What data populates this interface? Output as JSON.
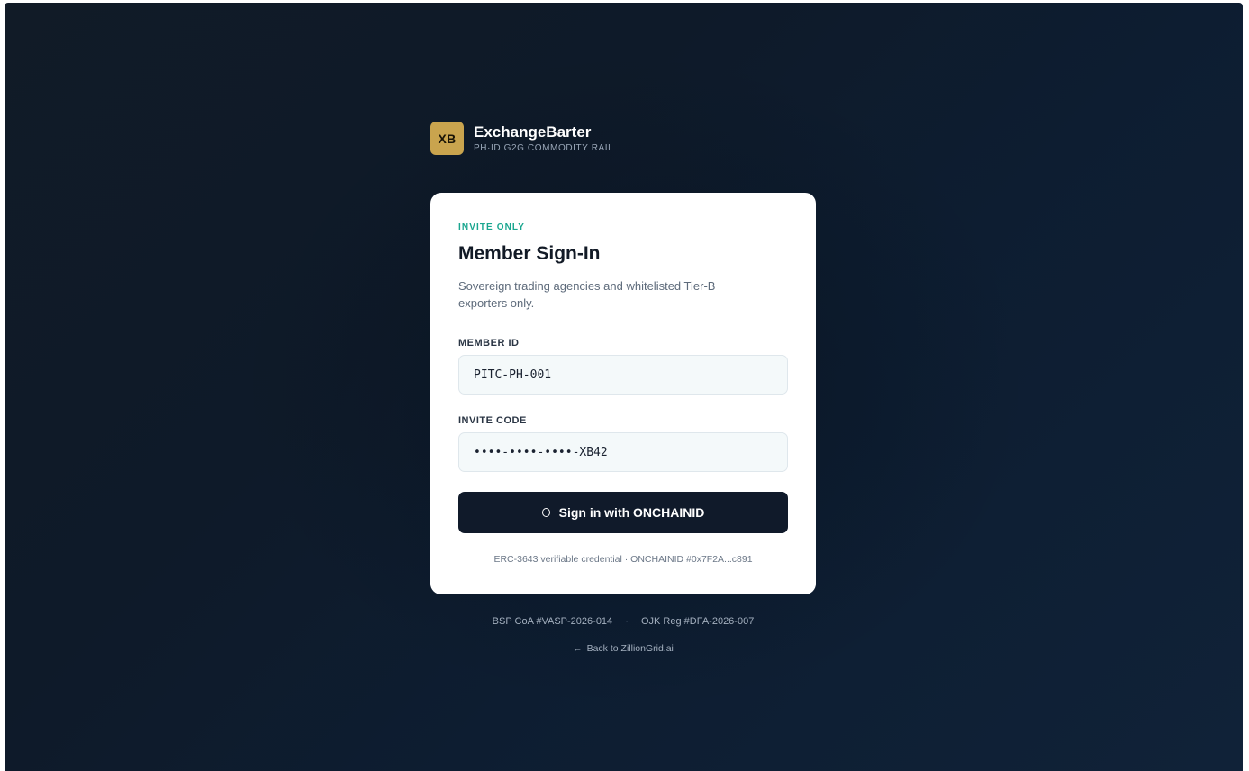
{
  "brand": {
    "logo_text": "XB",
    "name": "ExchangeBarter",
    "subtitle": "PH·ID G2G COMMODITY RAIL"
  },
  "card": {
    "eyebrow": "INVITE ONLY",
    "title": "Member Sign-In",
    "description": "Sovereign trading agencies and whitelisted Tier-B exporters only.",
    "member_id": {
      "label": "MEMBER ID",
      "value": "PITC-PH-001"
    },
    "invite_code": {
      "label": "INVITE CODE",
      "value": "••••-••••-••••-XB42"
    },
    "signin_button": {
      "label": "Sign in with ONCHAINID",
      "icon": "ring-icon"
    },
    "credential_note": "ERC-3643 verifiable credential · ONCHAINID #0x7F2A...c891"
  },
  "footer": {
    "bsp_reg": "BSP CoA #VASP-2026-014",
    "separator": "·",
    "ojk_reg": "OJK Reg #DFA-2026-007",
    "back_link": "Back to ZillionGrid.ai",
    "back_icon": "arrow-left-icon"
  },
  "colors": {
    "accent_gold": "#c9a44e",
    "eyebrow_teal": "#1aa68f",
    "button_dark": "#101a2a",
    "background_navy": "#0e1a29"
  }
}
